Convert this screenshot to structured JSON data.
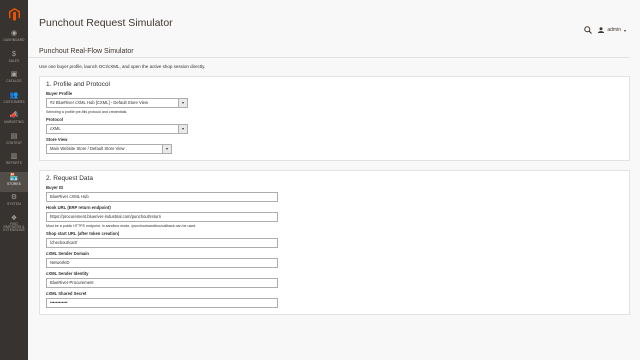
{
  "sidebar": {
    "items": [
      {
        "label": "Dashboard",
        "icon": "speedometer-icon",
        "glyph": "◉",
        "active": false
      },
      {
        "label": "Sales",
        "icon": "dollar-icon",
        "glyph": "$",
        "active": false
      },
      {
        "label": "Catalog",
        "icon": "cube-icon",
        "glyph": "▣",
        "active": false
      },
      {
        "label": "Customers",
        "icon": "customers-icon",
        "glyph": "👥",
        "active": false
      },
      {
        "label": "Marketing",
        "icon": "megaphone-icon",
        "glyph": "📣",
        "active": false
      },
      {
        "label": "Content",
        "icon": "content-icon",
        "glyph": "▤",
        "active": false
      },
      {
        "label": "Reports",
        "icon": "bar-chart-icon",
        "glyph": "▥",
        "active": false
      },
      {
        "label": "Stores",
        "icon": "store-icon",
        "glyph": "🏪",
        "active": true
      },
      {
        "label": "System",
        "icon": "gear-icon",
        "glyph": "⚙",
        "active": false
      },
      {
        "label": "Find Partners & Extensions",
        "icon": "extensions-icon",
        "glyph": "❖",
        "active": false
      }
    ]
  },
  "header": {
    "title": "Punchout Request Simulator",
    "search_icon": "search-icon",
    "user_name": "admin"
  },
  "subtitle": "Punchout Real-Flow Simulator",
  "intro": "Use one buyer profile, launch OCI/cXML, and open the active shop session directly.",
  "section1": {
    "title": "1. Profile and Protocol",
    "buyer_profile_label": "Buyer Profile",
    "buyer_profile_value": "#2 BlueRiver cXML Hub [CXML] - Default Store View",
    "buyer_profile_note": "Selecting a profile pre-fills protocol and credentials.",
    "protocol_label": "Protocol",
    "protocol_value": "cXML",
    "store_view_label": "Store View",
    "store_view_value": "Main Website Store / Default Store View"
  },
  "section2": {
    "title": "2. Request Data",
    "buyer_id_label": "Buyer ID",
    "buyer_id_value": "BlueRiver cXML Hub",
    "hook_url_label": "Hook URL (ERP return endpoint)",
    "hook_url_value": "https://procurement.blueriver-industrial.com/punchout/return",
    "hook_url_note": "Must be a public HTTPS endpoint. In sandbox mode, /punchoutsandbox/callback can be used.",
    "shop_start_label": "Shop start URL (after token creation)",
    "shop_start_value": "/checkout/cart/",
    "sender_domain_label": "cXML Sender Domain",
    "sender_domain_value": "NetworkID",
    "sender_identity_label": "cXML Sender Identity",
    "sender_identity_value": "BlueRiver-Procurement",
    "shared_secret_label": "cXML Shared Secret",
    "shared_secret_value": "••••••••••••"
  }
}
